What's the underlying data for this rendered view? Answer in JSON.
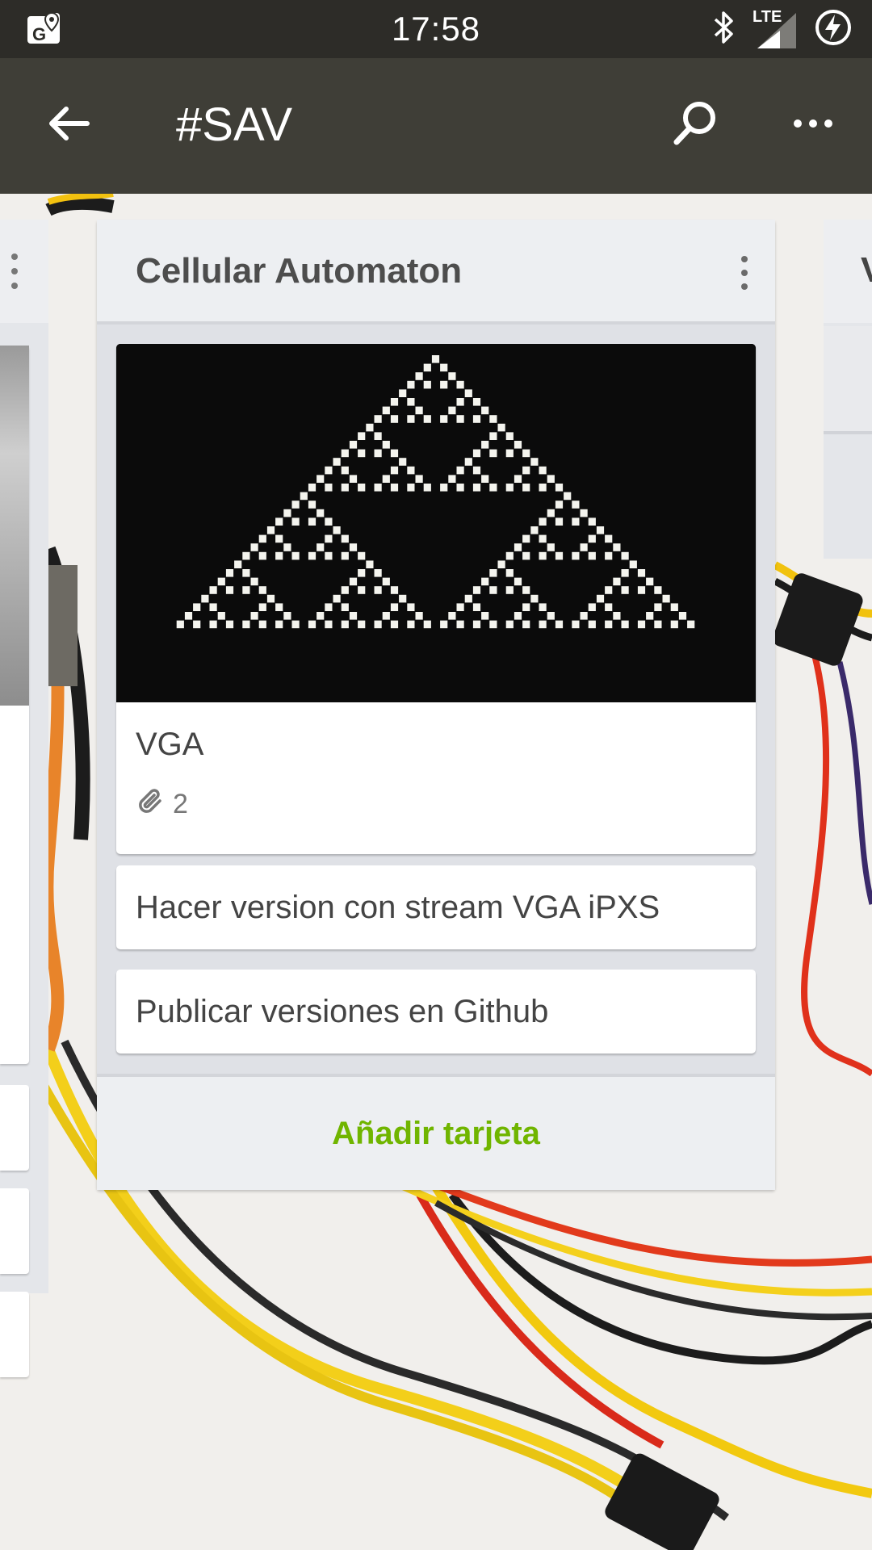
{
  "status_bar": {
    "time": "17:58",
    "network_label": "LTE",
    "icons": [
      "maps-notification-icon",
      "bluetooth-icon",
      "signal-icon",
      "battery-charging-icon"
    ]
  },
  "app_bar": {
    "title": "#SAV",
    "icons": [
      "back-arrow-icon",
      "search-icon",
      "more-horizontal-icon"
    ]
  },
  "list": {
    "title": "Cellular Automaton",
    "cards": [
      {
        "title": "VGA",
        "has_cover": true,
        "attachments": "2"
      },
      {
        "title": "Hacer version con stream VGA iPXS"
      },
      {
        "title": "Publicar versiones en Github"
      }
    ],
    "add_card_label": "Añadir tarjeta"
  },
  "adjacent_list": {
    "title_fragment": "V"
  },
  "colors": {
    "status_bar": "#2d2c28",
    "app_bar": "#3f3e37",
    "list_bg": "#dfe1e6",
    "list_header_bg": "#edeff2",
    "accent_green": "#70b500"
  }
}
